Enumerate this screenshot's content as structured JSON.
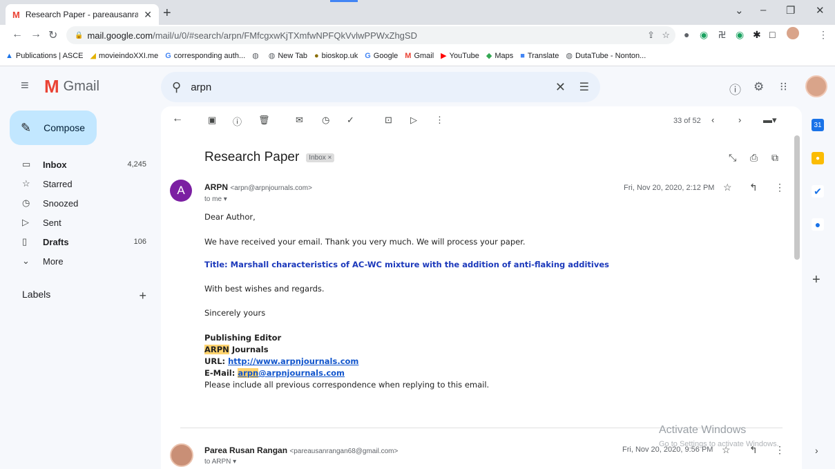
{
  "browser": {
    "tab_title": "Research Paper - pareausanranga",
    "url_host": "mail.google.com",
    "url_path": "/mail/u/0/#search/arpn/FMfcgxwKjTXmfwNPFQkVvlwPPWxZhgSD",
    "bookmarks": [
      {
        "label": "Publications | ASCE",
        "icon": "asce-icon"
      },
      {
        "label": "movieindoXXI.me",
        "icon": "bird-icon"
      },
      {
        "label": "corresponding auth...",
        "icon": "google-icon"
      },
      {
        "label": "",
        "icon": "globe-icon"
      },
      {
        "label": "New Tab",
        "icon": "globe-icon"
      },
      {
        "label": "bioskop.uk",
        "icon": "bioskop-icon"
      },
      {
        "label": "Google",
        "icon": "google-icon"
      },
      {
        "label": "Gmail",
        "icon": "gmail-icon"
      },
      {
        "label": "YouTube",
        "icon": "youtube-icon"
      },
      {
        "label": "Maps",
        "icon": "maps-icon"
      },
      {
        "label": "Translate",
        "icon": "translate-icon"
      },
      {
        "label": "DutaTube - Nonton...",
        "icon": "globe-icon"
      }
    ]
  },
  "gmail": {
    "logo_text": "Gmail",
    "search_value": "arpn",
    "compose_label": "Compose",
    "nav": [
      {
        "label": "Inbox",
        "count": "4,245",
        "icon": "inbox-icon",
        "bold": true
      },
      {
        "label": "Starred",
        "count": "",
        "icon": "star-icon",
        "bold": false
      },
      {
        "label": "Snoozed",
        "count": "",
        "icon": "clock-icon",
        "bold": false
      },
      {
        "label": "Sent",
        "count": "",
        "icon": "send-icon",
        "bold": false
      },
      {
        "label": "Drafts",
        "count": "106",
        "icon": "draft-icon",
        "bold": true
      },
      {
        "label": "More",
        "count": "",
        "icon": "chevron-down-icon",
        "bold": false
      }
    ],
    "labels_title": "Labels",
    "pager": "33 of 52"
  },
  "email": {
    "subject": "Research Paper",
    "inbox_chip": "Inbox ×",
    "sender_initial": "A",
    "sender_name": "ARPN",
    "sender_email": "<arpn@arpnjournals.com>",
    "to": "to me ▾",
    "date": "Fri, Nov 20, 2020, 2:12 PM",
    "greeting": "Dear Author,",
    "line1": "We have received your email. Thank you very much. We will process your paper.",
    "title_label": "Title: ",
    "title_value": "Marshall characteristics of AC-WC mixture with the addition of anti-flaking additives",
    "regards": "With best wishes and regards.",
    "sincerely": "Sincerely yours",
    "sig_role": "Publishing Editor",
    "sig_org_hl": "ARPN",
    "sig_org_rest": " Journals",
    "url_label": "URL: ",
    "url_value": "http://www.arpnjournals.com",
    "email_label": "E-Mail: ",
    "email_hl": "arpn",
    "email_rest": "@arpnjournals.com",
    "footer_note": "Please include all previous correspondence when replying to this email."
  },
  "reply": {
    "sender_name": "Parea Rusan Rangan",
    "sender_email": "<pareausanrangan68@gmail.com>",
    "to": "to ARPN ▾",
    "date": "Fri, Nov 20, 2020, 9:56 PM"
  },
  "watermark": {
    "line1": "Activate Windows",
    "line2": "Go to Settings to activate Windows."
  }
}
